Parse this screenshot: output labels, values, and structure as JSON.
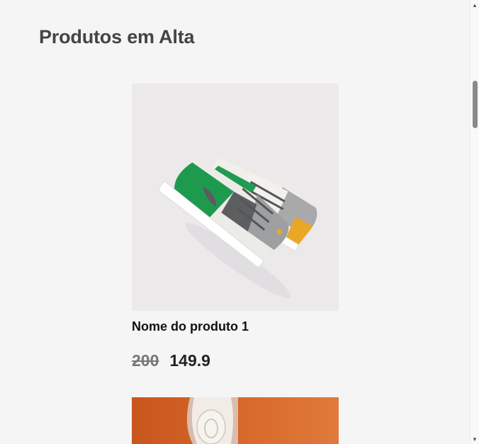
{
  "section": {
    "title": "Produtos em Alta"
  },
  "products": [
    {
      "name": "Nome do produto 1",
      "price_old": "200",
      "price_new": "149.9",
      "image_icon": "sneaker-image"
    },
    {
      "image_icon": "sneaker-image"
    }
  ],
  "colors": {
    "background": "#f5f5f5",
    "title_text": "#444444",
    "old_price": "#777777",
    "new_price": "#222222",
    "image_bg": "#ebe9ea",
    "image2_bg": "#d8692b"
  },
  "scrollbar": {
    "up_icon": "arrow-up-icon",
    "down_icon": "arrow-down-icon"
  }
}
